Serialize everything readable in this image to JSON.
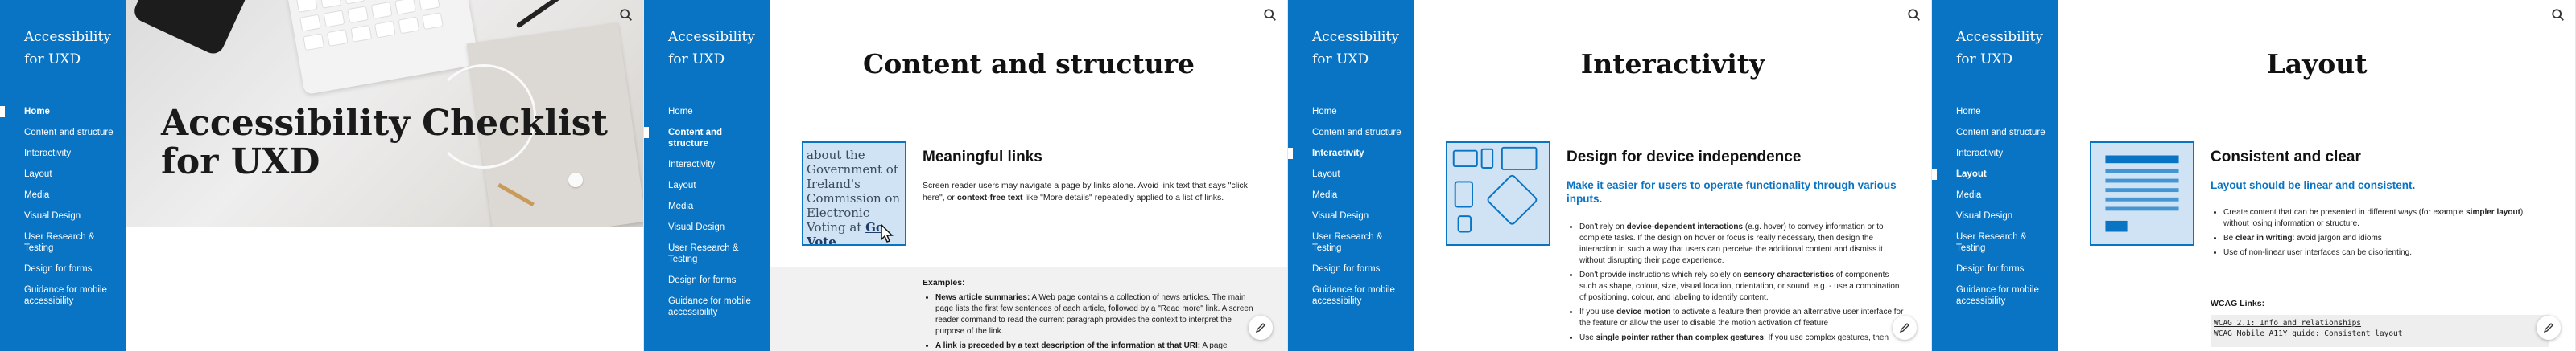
{
  "brand": "Accessibility for UXD",
  "nav": [
    "Home",
    "Content and structure",
    "Interactivity",
    "Layout",
    "Media",
    "Visual Design",
    "User Research & Testing",
    "Design for forms",
    "Guidance for mobile accessibility"
  ],
  "icons": {
    "search": "search-icon",
    "edit": "pencil-icon"
  },
  "colors": {
    "accent": "#0a74c4",
    "illustration_bg": "#cfe3f4"
  },
  "home": {
    "hero_title": "Accessibility Checklist for UXD"
  },
  "content": {
    "title": "Content and structure",
    "illustration_text": "about the Government of Ireland's Commission on Electronic Voting at",
    "illustration_link": "Go Vote",
    "section_title": "Meaningful links",
    "body": "Screen reader users may navigate a page by links alone. Avoid link text that says \"click here\", or",
    "body_bold": "context-free text",
    "body_tail": "like \"More details\" repeatedly applied to a list of links.",
    "examples_label": "Examples:",
    "example1_bold": "News article summaries:",
    "example1": "A Web page contains a collection of news articles. The main page lists the first few sentences of each article, followed by a \"Read more\" link. A screen reader command to read the current paragraph provides the context to interpret the purpose of the link.",
    "example2_bold": "A link is preceded by a text description of the information at that URI:",
    "example2": "A page"
  },
  "interactivity": {
    "title": "Interactivity",
    "section_title": "Design for device independence",
    "lead": "Make it easier for users to operate functionality through various inputs.",
    "b1_pre": "Don't rely on",
    "b1_bold": "device-dependent interactions",
    "b1_post": "(e.g. hover) to convey information or to complete tasks. If the design on hover or focus is really necessary, then design the interaction in such a way that users can perceive the additional content and dismiss it without disrupting their page experience.",
    "b2_pre": "Don't provide instructions which rely solely on",
    "b2_bold": "sensory characteristics",
    "b2_post": "of components such as shape, colour, size, visual location, orientation, or sound. e.g. - use a combination of positioning, colour, and labeling to identify content.",
    "b3_pre": "If you use",
    "b3_bold": "device motion",
    "b3_post": "to activate a feature then provide an alternative user interface for the feature or allow the user to disable the motion activation of feature",
    "b4_pre": "Use",
    "b4_bold": "single pointer rather than complex gestures",
    "b4_post": ": If you use complex gestures, then"
  },
  "layout": {
    "title": "Layout",
    "section_title": "Consistent and clear",
    "lead": "Layout should be linear and consistent.",
    "b1_pre": "Create content that can be presented in different ways (for example",
    "b1_bold": "simpler layout",
    "b1_post": ") without losing information or structure.",
    "b2_pre": "Be",
    "b2_bold": "clear in writing",
    "b2_post": ": avoid jargon and idioms",
    "b3": "Use of non-linear user interfaces can be disorienting.",
    "wcag_label": "WCAG Links:",
    "wcag1": "WCAG 2.1: Info and relationships",
    "wcag2": "WCAG Mobile A11Y guide: Consistent layout"
  }
}
